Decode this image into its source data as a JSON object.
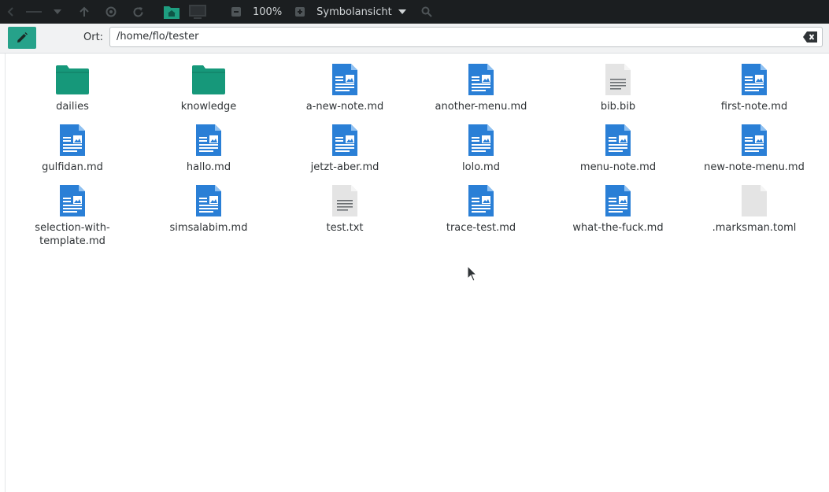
{
  "toolbar": {
    "zoom": "100%",
    "view_mode": "Symbolansicht"
  },
  "location": {
    "label": "Ort:",
    "path": "/home/flo/tester"
  },
  "colors": {
    "accent": "#26a28a",
    "folder": "#16987a",
    "document": "#2a7fd6",
    "plain": "#e4e4e4"
  },
  "files": [
    {
      "name": "dailies",
      "icon": "folder-icon"
    },
    {
      "name": "knowledge",
      "icon": "folder-icon"
    },
    {
      "name": "a-new-note.md",
      "icon": "markdown-file-icon"
    },
    {
      "name": "another-menu.md",
      "icon": "markdown-file-icon"
    },
    {
      "name": "bib.bib",
      "icon": "text-file-icon"
    },
    {
      "name": "first-note.md",
      "icon": "markdown-file-icon"
    },
    {
      "name": "gulfidan.md",
      "icon": "markdown-file-icon"
    },
    {
      "name": "hallo.md",
      "icon": "markdown-file-icon"
    },
    {
      "name": "jetzt-aber.md",
      "icon": "markdown-file-icon"
    },
    {
      "name": "lolo.md",
      "icon": "markdown-file-icon"
    },
    {
      "name": "menu-note.md",
      "icon": "markdown-file-icon"
    },
    {
      "name": "new-note-menu.md",
      "icon": "markdown-file-icon"
    },
    {
      "name": "selection-with-template.md",
      "icon": "markdown-file-icon"
    },
    {
      "name": "simsalabim.md",
      "icon": "markdown-file-icon"
    },
    {
      "name": "test.txt",
      "icon": "text-file-icon"
    },
    {
      "name": "trace-test.md",
      "icon": "markdown-file-icon"
    },
    {
      "name": "what-the-fuck.md",
      "icon": "markdown-file-icon"
    },
    {
      "name": ".marksman.toml",
      "icon": "blank-file-icon"
    }
  ]
}
